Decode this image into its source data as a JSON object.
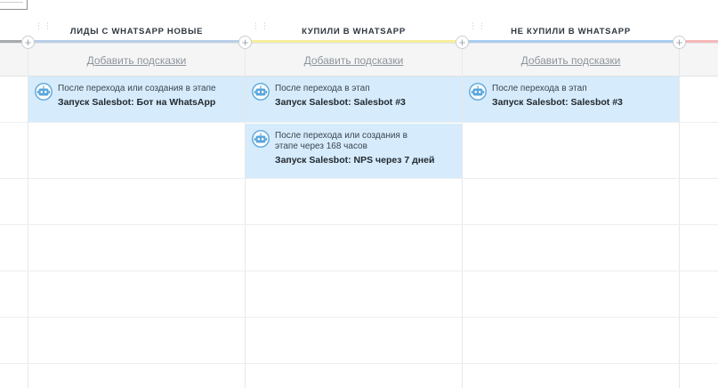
{
  "columns": [
    {
      "title": "ЛИДЫ С WHATSAPP НОВЫЕ",
      "accent": "#b9cfe8",
      "hint_link": "Добавить подсказки"
    },
    {
      "title": "КУПИЛИ В WHATSAPP",
      "accent": "#f6ee9c",
      "hint_link": "Добавить подсказки"
    },
    {
      "title": "НЕ КУПИЛИ В WHATSAPP",
      "accent": "#a9cdf0",
      "hint_link": "Добавить подсказки"
    }
  ],
  "edge_lines": {
    "left_accent": "#a6a9ad",
    "right_accent": "#f6b9b9"
  },
  "triggers": {
    "col1_card1": {
      "line1": "После перехода или создания в этапе",
      "line2": "Запуск Salesbot: Бот на WhatsApp"
    },
    "col2_card1": {
      "line1": "После перехода в этап",
      "line2": "Запуск Salesbot: Salesbot #3"
    },
    "col2_card2": {
      "line1a": "После перехода или создания в",
      "line1b": "этапе через 168 часов",
      "line2": "Запуск Salesbot: NPS через 7 дней"
    },
    "col3_card1": {
      "line1": "После перехода в этап",
      "line2": "Запуск Salesbot: Salesbot #3"
    }
  },
  "colors": {
    "card_bg": "#d6ebfb",
    "robot_icon": "#5aa6dc"
  },
  "icons": {
    "add_stage": "plus-icon",
    "trigger": "robot-icon",
    "drag": "drag-handle-icon"
  }
}
